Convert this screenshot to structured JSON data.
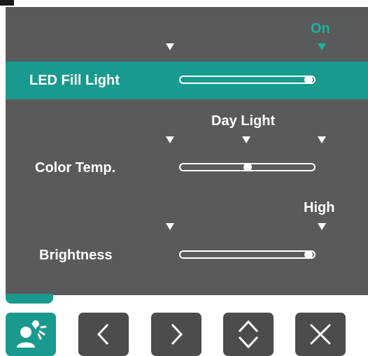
{
  "menu": {
    "rows": [
      {
        "id": "led",
        "label": "LED Fill Light",
        "value_text": "On",
        "level": 1.0
      },
      {
        "id": "color",
        "label": "Color Temp.",
        "value_text": "Day Light",
        "level": 0.5
      },
      {
        "id": "brightness",
        "label": "Brightness",
        "value_text": "High",
        "level": 1.0
      }
    ]
  },
  "buttons": [
    {
      "icon": "user-cast-icon",
      "active": true
    },
    {
      "icon": "chevron-left-icon",
      "active": false
    },
    {
      "icon": "chevron-right-icon",
      "active": false
    },
    {
      "icon": "up-down-icon",
      "active": false
    },
    {
      "icon": "close-icon",
      "active": false
    }
  ],
  "colors": {
    "accent": "#1a9a8f",
    "accent_text": "#1ab4a5",
    "panel": "#595a5c",
    "button": "#4b4c4e"
  }
}
